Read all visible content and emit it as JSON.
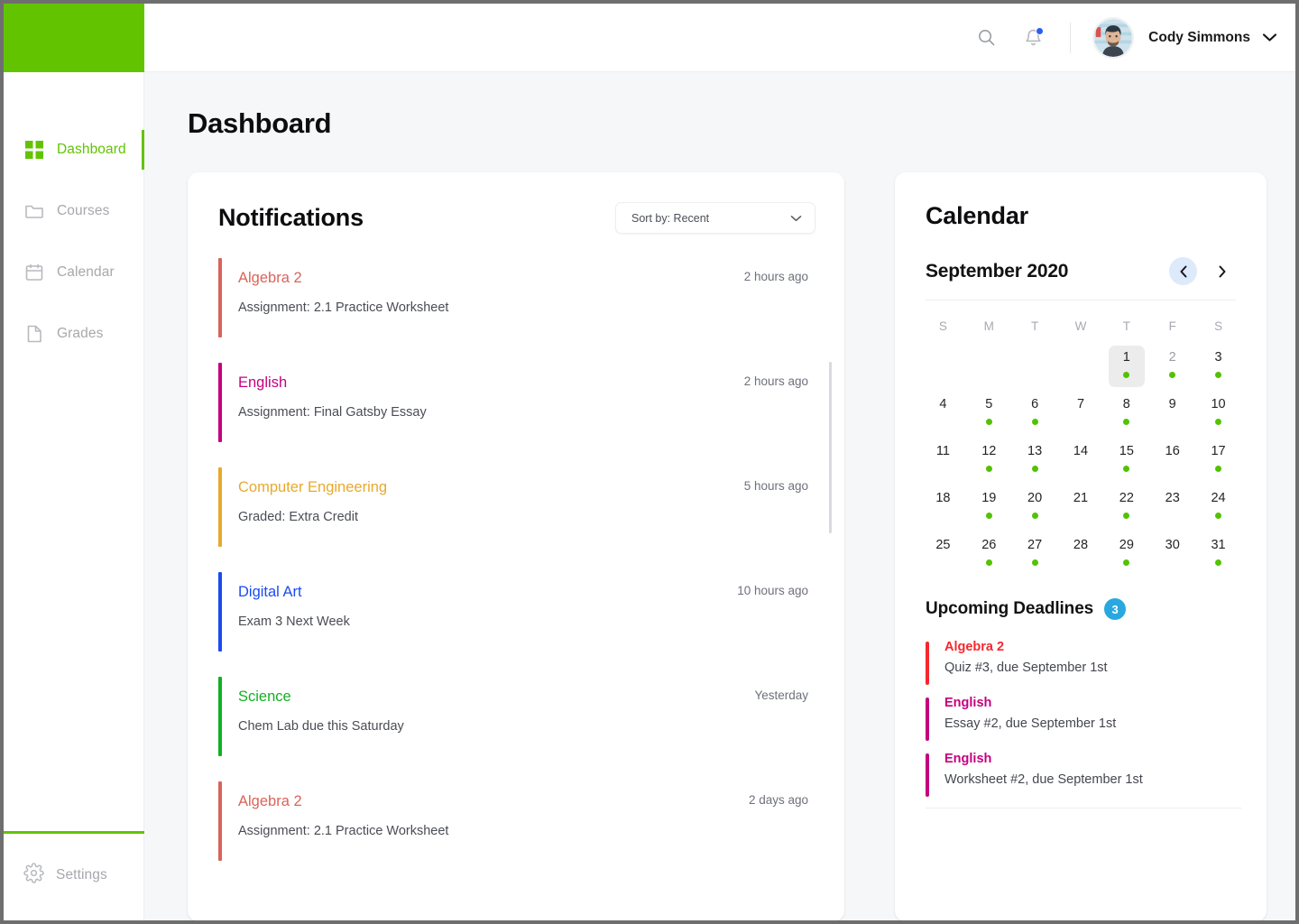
{
  "brand": {
    "logo_color": "#62c400"
  },
  "sidebar": {
    "items": [
      {
        "label": "Dashboard",
        "icon": "grid-icon",
        "active": true
      },
      {
        "label": "Courses",
        "icon": "folder-icon",
        "active": false
      },
      {
        "label": "Calendar",
        "icon": "calendar-icon",
        "active": false
      },
      {
        "label": "Grades",
        "icon": "document-icon",
        "active": false
      }
    ],
    "settings": {
      "label": "Settings",
      "icon": "gear-icon"
    }
  },
  "topbar": {
    "search_icon": "search-icon",
    "bell_icon": "bell-icon",
    "has_notification_dot": true,
    "user_name": "Cody Simmons",
    "chevron_icon": "chevron-down-icon",
    "avatar": "avatar"
  },
  "page": {
    "title": "Dashboard"
  },
  "notifications": {
    "title": "Notifications",
    "sort": {
      "label": "Sort by: Recent",
      "chevron": "chevron-down-icon"
    },
    "items": [
      {
        "course": "Algebra 2",
        "desc": "Assignment: 2.1 Practice Worksheet",
        "time": "2 hours ago",
        "color": "#d96459"
      },
      {
        "course": "English",
        "desc": "Assignment: Final Gatsby Essay",
        "time": "2 hours ago",
        "color": "#c5007e"
      },
      {
        "course": "Computer Engineering",
        "desc": "Graded: Extra Credit",
        "time": "5 hours ago",
        "color": "#e8a92e"
      },
      {
        "course": "Digital Art",
        "desc": "Exam 3 Next Week",
        "time": "10 hours ago",
        "color": "#1b4bf0"
      },
      {
        "course": "Science",
        "desc": "Chem Lab due this Saturday",
        "time": "Yesterday",
        "color": "#12b024"
      },
      {
        "course": "Algebra 2",
        "desc": "Assignment: 2.1 Practice Worksheet",
        "time": "2 days ago",
        "color": "#d96459"
      }
    ]
  },
  "calendar": {
    "title": "Calendar",
    "month_label": "September 2020",
    "prev_icon": "chevron-left-icon",
    "next_icon": "chevron-right-icon",
    "weekdays": [
      "S",
      "M",
      "T",
      "W",
      "T",
      "F",
      "S"
    ],
    "leading_blanks": 4,
    "days": [
      {
        "n": 1,
        "dot": true,
        "today": true,
        "muted": false
      },
      {
        "n": 2,
        "dot": true,
        "today": false,
        "muted": true
      },
      {
        "n": 3,
        "dot": true,
        "today": false,
        "muted": false
      },
      {
        "n": 4,
        "dot": false,
        "today": false,
        "muted": false
      },
      {
        "n": 5,
        "dot": true,
        "today": false,
        "muted": false
      },
      {
        "n": 6,
        "dot": true,
        "today": false,
        "muted": false
      },
      {
        "n": 7,
        "dot": false,
        "today": false,
        "muted": false
      },
      {
        "n": 8,
        "dot": true,
        "today": false,
        "muted": false
      },
      {
        "n": 9,
        "dot": false,
        "today": false,
        "muted": false
      },
      {
        "n": 10,
        "dot": true,
        "today": false,
        "muted": false
      },
      {
        "n": 11,
        "dot": false,
        "today": false,
        "muted": false
      },
      {
        "n": 12,
        "dot": true,
        "today": false,
        "muted": false
      },
      {
        "n": 13,
        "dot": true,
        "today": false,
        "muted": false
      },
      {
        "n": 14,
        "dot": false,
        "today": false,
        "muted": false
      },
      {
        "n": 15,
        "dot": true,
        "today": false,
        "muted": false
      },
      {
        "n": 16,
        "dot": false,
        "today": false,
        "muted": false
      },
      {
        "n": 17,
        "dot": true,
        "today": false,
        "muted": false
      },
      {
        "n": 18,
        "dot": false,
        "today": false,
        "muted": false
      },
      {
        "n": 19,
        "dot": true,
        "today": false,
        "muted": false
      },
      {
        "n": 20,
        "dot": true,
        "today": false,
        "muted": false
      },
      {
        "n": 21,
        "dot": false,
        "today": false,
        "muted": false
      },
      {
        "n": 22,
        "dot": true,
        "today": false,
        "muted": false
      },
      {
        "n": 23,
        "dot": false,
        "today": false,
        "muted": false
      },
      {
        "n": 24,
        "dot": true,
        "today": false,
        "muted": false
      },
      {
        "n": 25,
        "dot": false,
        "today": false,
        "muted": false
      },
      {
        "n": 26,
        "dot": true,
        "today": false,
        "muted": false
      },
      {
        "n": 27,
        "dot": true,
        "today": false,
        "muted": false
      },
      {
        "n": 28,
        "dot": false,
        "today": false,
        "muted": false
      },
      {
        "n": 29,
        "dot": true,
        "today": false,
        "muted": false
      },
      {
        "n": 30,
        "dot": false,
        "today": false,
        "muted": false
      },
      {
        "n": 31,
        "dot": true,
        "today": false,
        "muted": false
      }
    ],
    "dot_color": "#53c200"
  },
  "deadlines": {
    "title": "Upcoming Deadlines",
    "count": "3",
    "badge_color": "#29a8e0",
    "items": [
      {
        "course": "Algebra 2",
        "desc": "Quiz #3, due September 1st",
        "color": "#f5282d"
      },
      {
        "course": "English",
        "desc": "Essay #2, due September 1st",
        "color": "#c5007e"
      },
      {
        "course": "English",
        "desc": "Worksheet #2, due September 1st",
        "color": "#c5007e"
      }
    ]
  }
}
